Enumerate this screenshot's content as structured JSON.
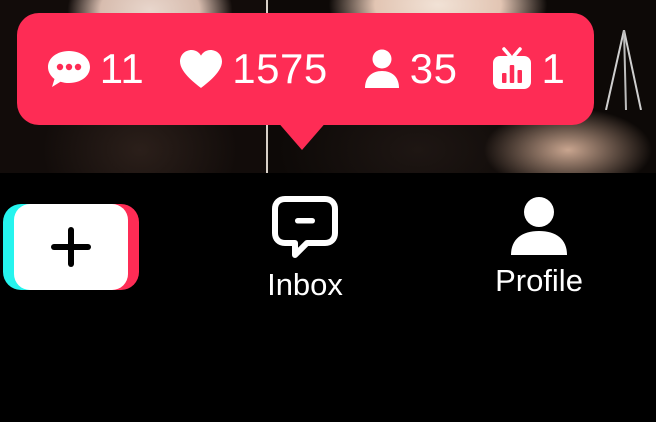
{
  "stats": {
    "comments": "11",
    "likes": "1575",
    "viewers": "35",
    "gifts": "1"
  },
  "nav": {
    "create_icon": "plus-icon",
    "inbox_label": "Inbox",
    "inbox_icon": "message-bubble-icon",
    "profile_label": "Profile",
    "profile_icon": "person-icon"
  },
  "colors": {
    "accent": "#fe2c55",
    "cyan": "#25f4ee",
    "background": "#000000",
    "text": "#ffffff"
  }
}
